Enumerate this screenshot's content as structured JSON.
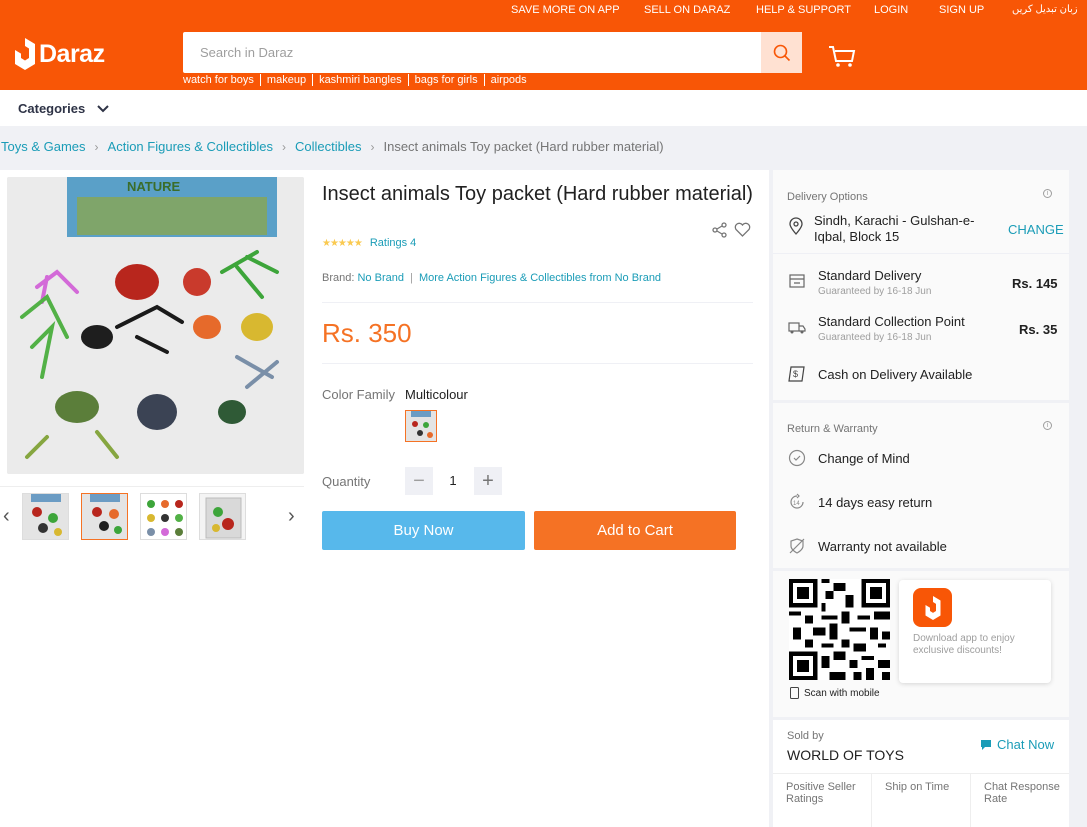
{
  "topnav": {
    "save_more": "SAVE MORE ON APP",
    "sell": "SELL ON DARAZ",
    "help": "HELP & SUPPORT",
    "login": "LOGIN",
    "signup": "SIGN UP",
    "language": "زبان تبدیل کریں"
  },
  "header": {
    "logo_text": "Daraz",
    "search_placeholder": "Search in Daraz",
    "search_icon": "search-icon",
    "cart_icon": "cart-icon",
    "brand_color": "#f85606"
  },
  "hot_words": [
    "watch for boys",
    "makeup",
    "kashmiri bangles",
    "bags for girls",
    "airpods"
  ],
  "categories_label": "Categories",
  "breadcrumb": {
    "items": [
      "Toys & Games",
      "Action Figures & Collectibles",
      "Collectibles"
    ],
    "current": "Insect animals Toy packet (Hard rubber material)"
  },
  "product": {
    "title": "Insect animals Toy packet (Hard rubber material)",
    "rating_stars": 4.5,
    "ratings_text": "Ratings 4",
    "brand_label": "Brand:",
    "brand": "No Brand",
    "more_from": "More Action Figures & Collectibles from No Brand",
    "price": "Rs. 350",
    "color_family_label": "Color Family",
    "color_family_value": "Multicolour",
    "quantity_label": "Quantity",
    "quantity": "1",
    "qty_minus": "−",
    "qty_plus": "+",
    "buy_now": "Buy Now",
    "add_to_cart": "Add to Cart",
    "image_main_alt": "insect toys photo",
    "box_text": "NATURE"
  },
  "delivery": {
    "heading": "Delivery Options",
    "location": "Sindh, Karachi - Gulshan-e-Iqbal, Block 15",
    "change": "CHANGE",
    "options": [
      {
        "title": "Standard Delivery",
        "sub": "Guaranteed by 16-18 Jun",
        "fee": "Rs. 145"
      },
      {
        "title": "Standard Collection Point",
        "sub": "Guaranteed by 16-18 Jun",
        "fee": "Rs. 35"
      }
    ],
    "cod": "Cash on Delivery Available"
  },
  "warranty": {
    "heading": "Return & Warranty",
    "items": [
      "Change of Mind",
      "14 days easy return",
      "Warranty not available"
    ]
  },
  "app_promo": {
    "scan": "Scan with mobile",
    "text": "Download app to enjoy exclusive discounts!"
  },
  "seller": {
    "sold_by": "Sold by",
    "name": "WORLD OF TOYS",
    "chat": "Chat Now",
    "metrics": [
      "Positive Seller Ratings",
      "Ship on Time",
      "Chat Response Rate"
    ]
  }
}
